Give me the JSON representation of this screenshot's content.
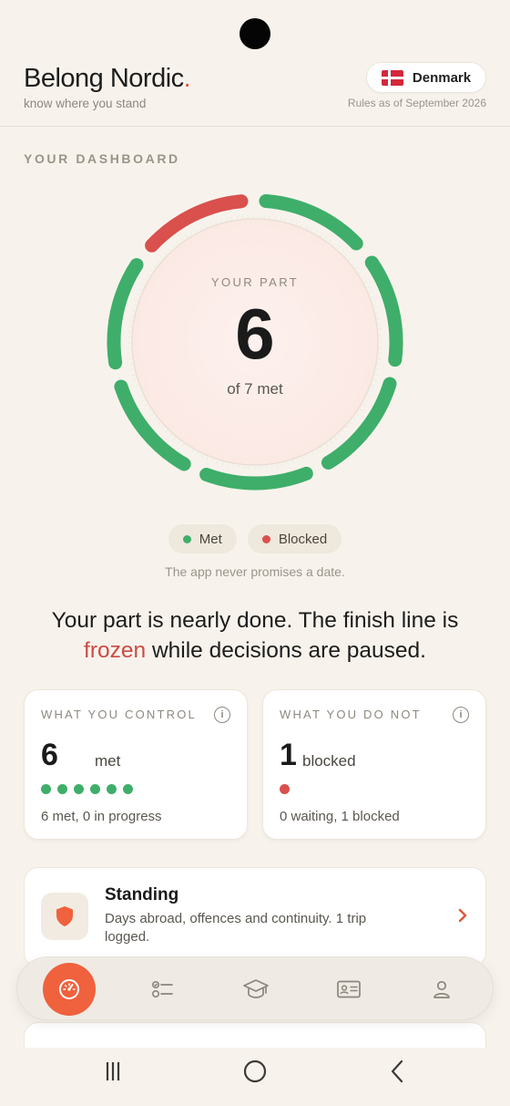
{
  "header": {
    "brand": "Belong Nordic",
    "brand_dot": ".",
    "tagline": "know where you stand",
    "country": "Denmark",
    "rules_date": "Rules as of September 2026"
  },
  "dashboard": {
    "section_label": "YOUR DASHBOARD",
    "ring": {
      "label": "YOUR PART",
      "value": "6",
      "sub": "of 7 met",
      "segments": [
        "blocked",
        "met",
        "met",
        "met",
        "met",
        "met",
        "met"
      ]
    },
    "legend": {
      "met": "Met",
      "blocked": "Blocked"
    },
    "disclaimer": "The app never promises a date.",
    "headline_part1": "Your part is nearly done. The finish line is ",
    "headline_highlight": "frozen",
    "headline_part2": " while decisions are paused."
  },
  "cards": {
    "control": {
      "label": "WHAT YOU CONTROL",
      "count": "6",
      "unit": "met",
      "dots": 6,
      "footer": "6 met, 0 in progress"
    },
    "not_control": {
      "label": "WHAT YOU DO NOT",
      "count": "1",
      "unit": "blocked",
      "dots": 1,
      "footer": "0 waiting, 1 blocked"
    }
  },
  "standing": {
    "title": "Standing",
    "description": "Days abroad, offences and continuity. 1 trip logged."
  },
  "nav": {
    "items": [
      "dashboard-icon",
      "checklist-icon",
      "graduation-cap-icon",
      "id-card-icon",
      "profile-icon"
    ],
    "active": 0
  },
  "colors": {
    "met": "#3fae6a",
    "blocked": "#d9504d",
    "accent": "#f0613d",
    "background": "#f7f3ec"
  }
}
